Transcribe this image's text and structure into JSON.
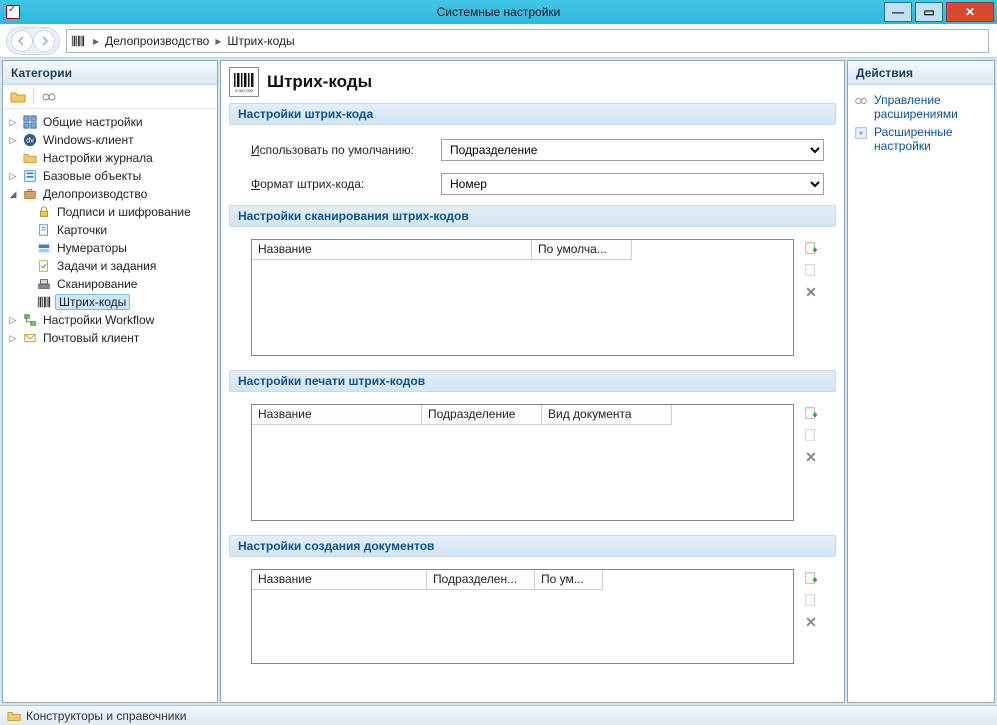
{
  "window": {
    "title": "Системные настройки"
  },
  "breadcrumb": {
    "item1": "Делопроизводство",
    "item2": "Штрих-коды"
  },
  "sidebar": {
    "header": "Категории",
    "nodes": {
      "general": "Общие настройки",
      "windows_client": "Windows-клиент",
      "journal": "Настройки журнала",
      "base_objects": "Базовые объекты",
      "docflow": "Делопроизводство",
      "signatures": "Подписи и шифрование",
      "cards": "Карточки",
      "numerators": "Нумераторы",
      "tasks": "Задачи и задания",
      "scanning": "Сканирование",
      "barcodes": "Штрих-коды",
      "workflow": "Настройки Workflow",
      "mail": "Почтовый клиент"
    }
  },
  "page": {
    "title": "Штрих-коды",
    "section_barcode_settings": "Настройки штрих-кода",
    "default_label": "Использовать по умолчанию:",
    "default_value": "Подразделение",
    "format_label": "Формат штрих-кода:",
    "format_value": "Номер",
    "section_scan": "Настройки сканирования штрих-кодов",
    "section_print": "Настройки печати штрих-кодов",
    "section_create": "Настройки создания документов",
    "col_name": "Название",
    "col_default": "По умолча...",
    "col_division": "Подразделение",
    "col_doctype": "Вид документа",
    "col_division_trunc": "Подразделен...",
    "col_default_trunc": "По ум..."
  },
  "actions": {
    "header": "Действия",
    "manage_ext": "Управление расширениями",
    "advanced": "Расширенные настройки"
  },
  "statusbar": {
    "text": "Конструкторы и справочники"
  }
}
